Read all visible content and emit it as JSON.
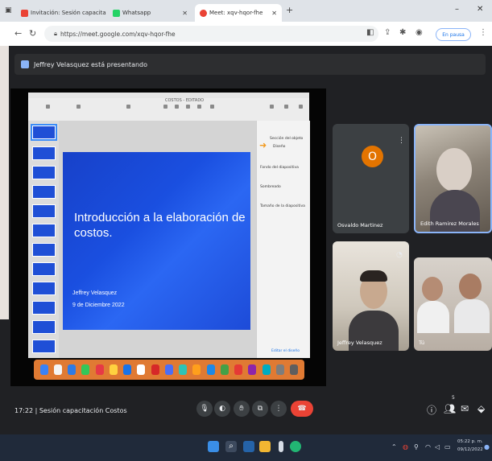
{
  "browser": {
    "tabs": [
      {
        "label": "Invitación: Sesión capacitación C",
        "favicon_color": "#ea4335"
      },
      {
        "label": "Whatsapp",
        "favicon_color": "#25d366"
      },
      {
        "label": "Meet: xqv-hqor-fhe",
        "favicon_color": "#ea4335"
      }
    ],
    "new_tab": "+",
    "minimize": "–",
    "close": "✕",
    "url": "https://meet.google.com/xqv-hqor-fhe",
    "paused_label": "En pausa"
  },
  "meet": {
    "presenting_banner": "Jeffrey Velasquez está presentando",
    "slide": {
      "title": "Introducción a la elaboración de costos.",
      "author": "Jeffrey Velasquez",
      "date": "9 de Diciembre 2022"
    },
    "keynote": {
      "doc_title": "COSTOS - EDITADO",
      "inspector": {
        "label1": "Sección del objeto",
        "label2": "Diseño",
        "label3": "Fondo del diapositiva",
        "label4": "Sombreado",
        "label5": "Tamaño de la diapositiva",
        "bottom": "Editar el diseño"
      }
    },
    "tiles": [
      {
        "name": "Osvaldo Martinez",
        "initial": "O"
      },
      {
        "name": "Edith Ramirez Morales"
      },
      {
        "name": "Jeffrey Velasquez"
      },
      {
        "name": "Tú"
      }
    ],
    "meeting_info": "17:22 | Sesión capacitación Costos",
    "participants_badge": "5"
  },
  "taskbar": {
    "time": "05:22 p. m.",
    "date": "09/12/2022"
  },
  "colors": {
    "meet_bg": "#202124",
    "slide_blue": "#1a4fe0",
    "end_call_red": "#ea4335",
    "dock_orange": "#e07a33",
    "taskbar_bg": "#202a3a"
  }
}
